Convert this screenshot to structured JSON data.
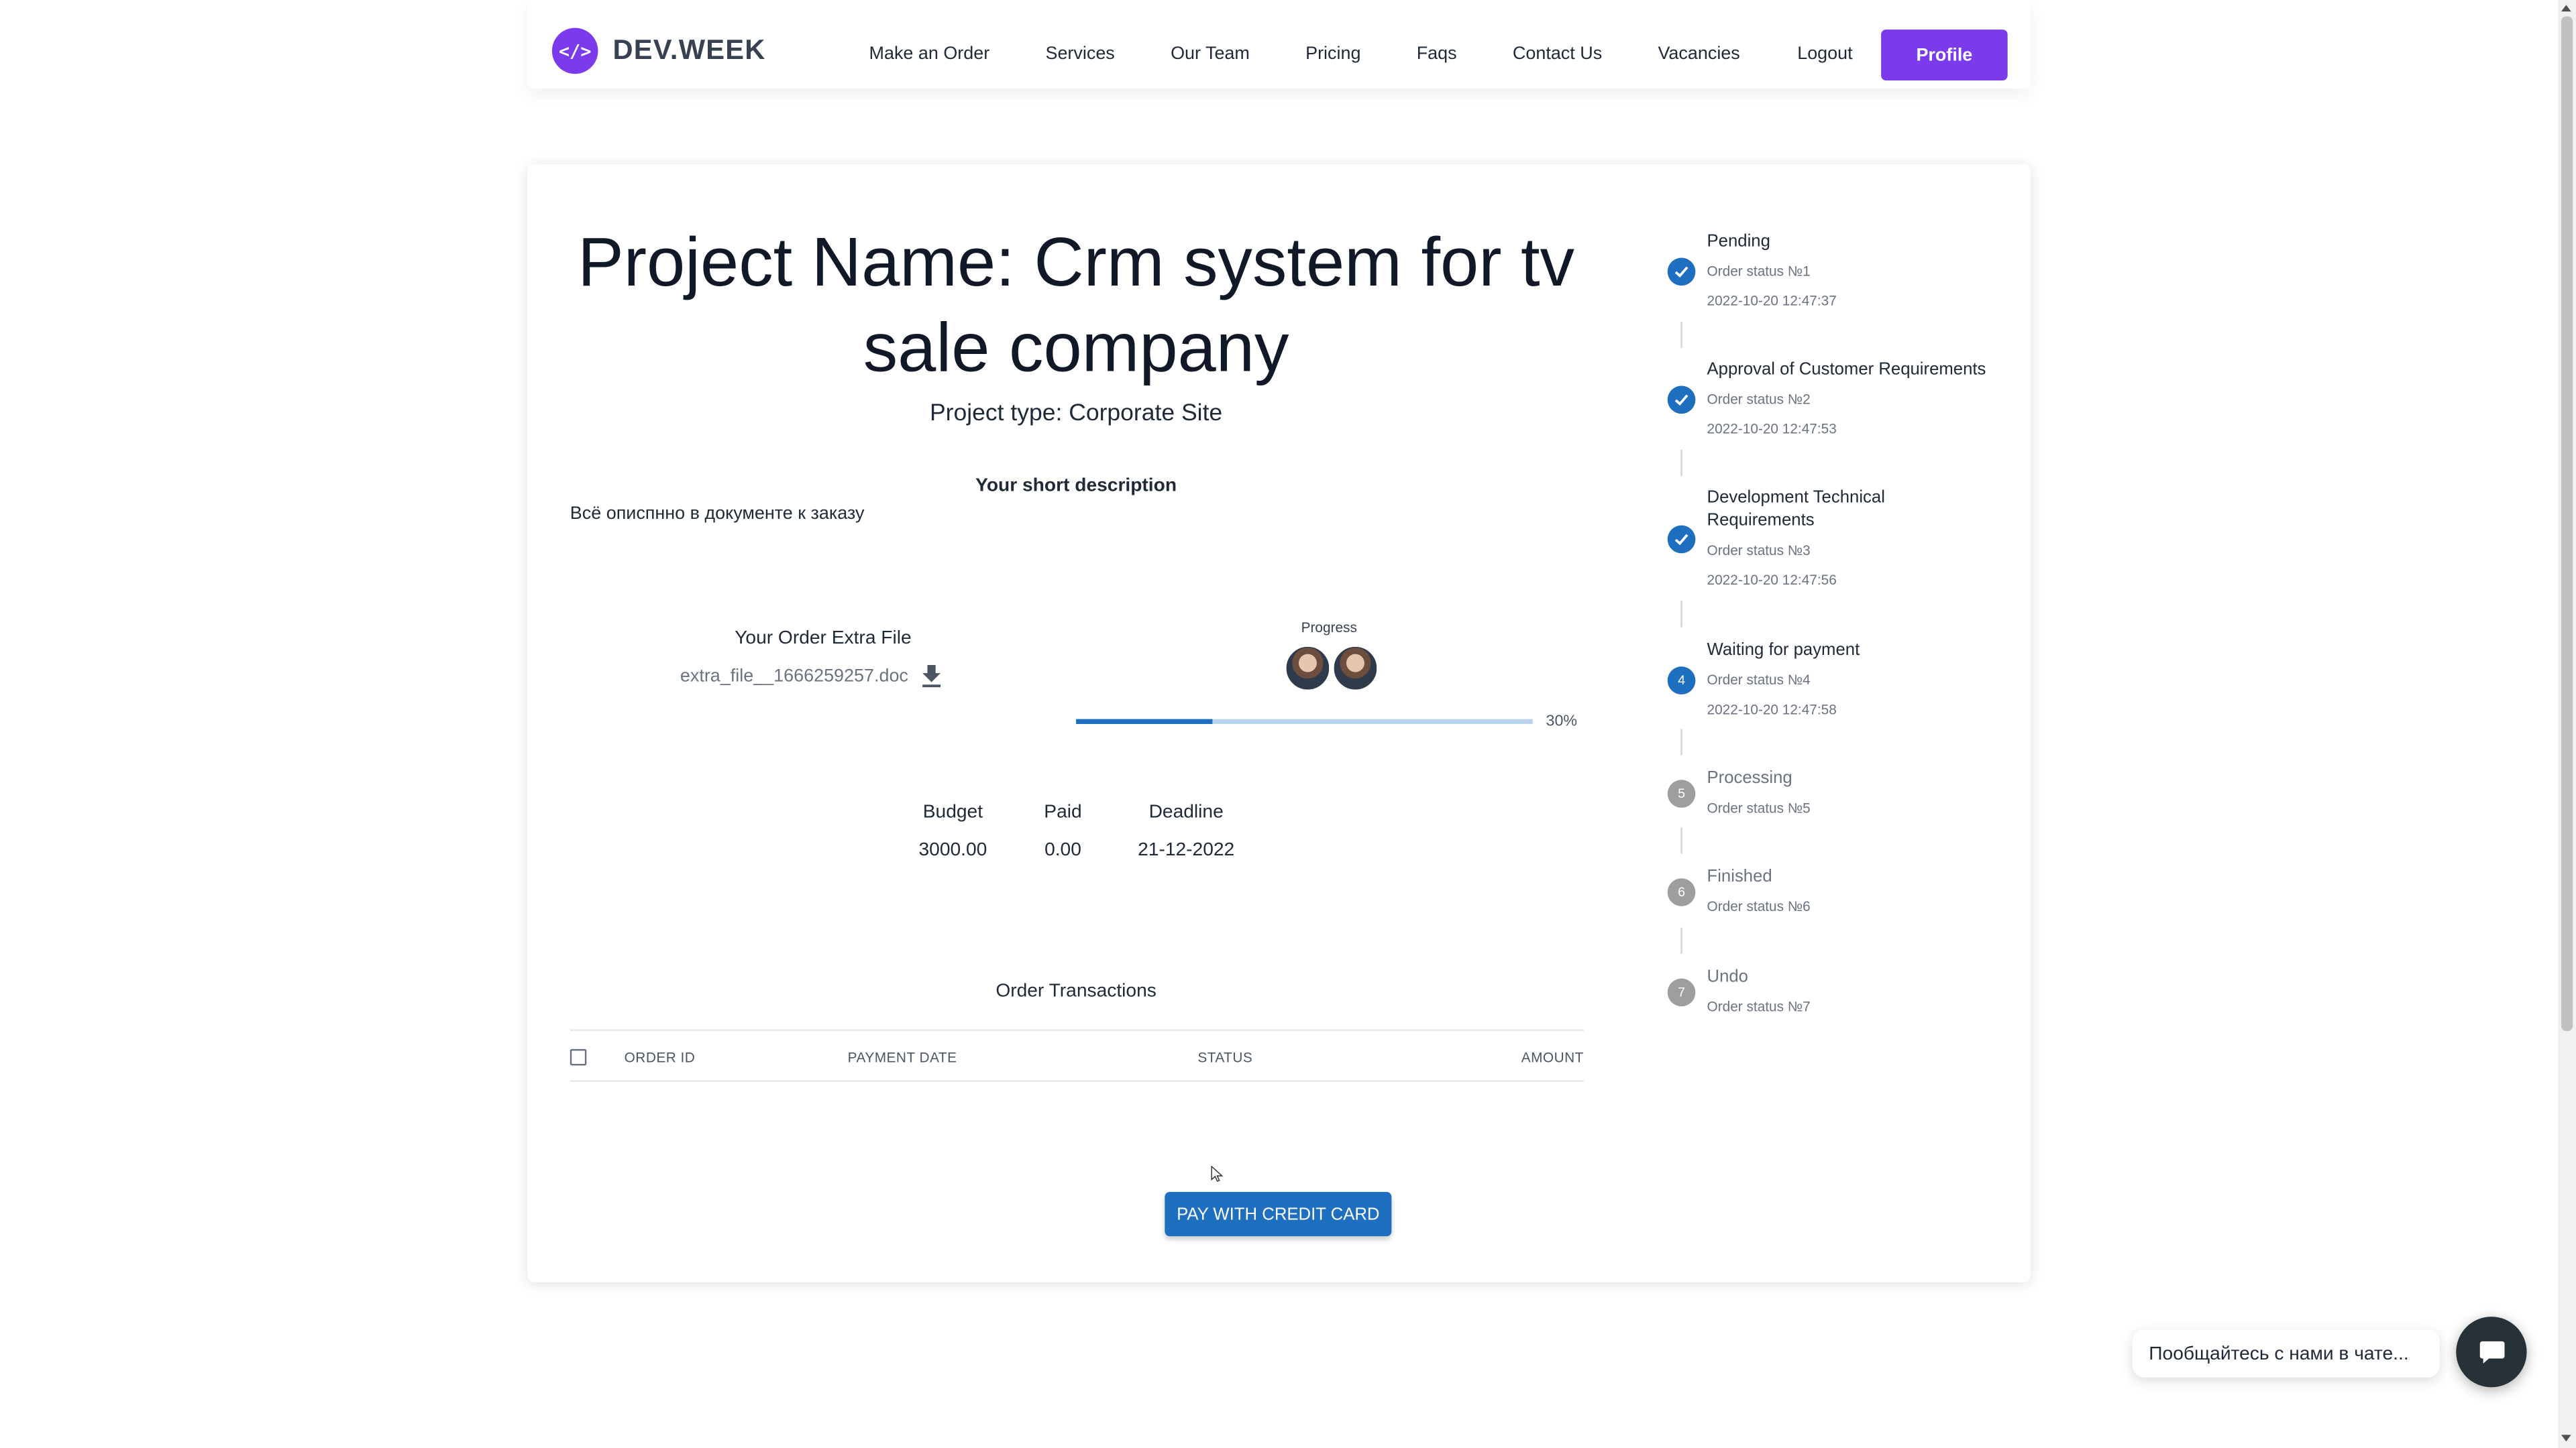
{
  "header": {
    "logo_symbol": "</>",
    "logo_text": "DEV.WEEK",
    "nav": [
      "Make an Order",
      "Services",
      "Our Team",
      "Pricing",
      "Faqs",
      "Contact Us",
      "Vacancies"
    ],
    "logout": "Logout",
    "profile": "Profile",
    "accent_color": "#7c3aed"
  },
  "project": {
    "title": "Project Name: Crm system for tv sale company",
    "type": "Project type: Corporate Site",
    "description_heading": "Your short description",
    "description": "Всё описпнно в документе к заказу",
    "file_heading": "Your Order Extra File",
    "file_name": "extra_file__1666259257.doc",
    "progress_label": "Progress",
    "progress_percent": 30,
    "progress_text": "30%",
    "budget_label": "Budget",
    "budget": "3000.00",
    "paid_label": "Paid",
    "paid": "0.00",
    "deadline_label": "Deadline",
    "deadline": "21-12-2022"
  },
  "transactions": {
    "heading": "Order Transactions",
    "columns": [
      "ORDER ID",
      "PAYMENT DATE",
      "STATUS",
      "AMOUNT"
    ],
    "rows": []
  },
  "pay_button": "PAY WITH CREDIT CARD",
  "status_steps": [
    {
      "title": "Pending",
      "subtitle": "Order status №1",
      "date": "2022-10-20 12:47:37",
      "state": "done"
    },
    {
      "title": "Approval of Customer Requirements",
      "subtitle": "Order status №2",
      "date": "2022-10-20 12:47:53",
      "state": "done"
    },
    {
      "title": "Development Technical Requirements",
      "subtitle": "Order status №3",
      "date": "2022-10-20 12:47:56",
      "state": "done"
    },
    {
      "title": "Waiting for payment",
      "subtitle": "Order status №4",
      "date": "2022-10-20 12:47:58",
      "state": "active",
      "number": "4"
    },
    {
      "title": "Processing",
      "subtitle": "Order status №5",
      "state": "pending",
      "number": "5"
    },
    {
      "title": "Finished",
      "subtitle": "Order status №6",
      "state": "pending",
      "number": "6"
    },
    {
      "title": "Undo",
      "subtitle": "Order status №7",
      "state": "pending",
      "number": "7"
    }
  ],
  "chat": {
    "prompt": "Пообщайтесь с нами в чате..."
  },
  "colors": {
    "primary_blue": "#1e6fc0",
    "pending_gray": "#9e9e9e"
  }
}
